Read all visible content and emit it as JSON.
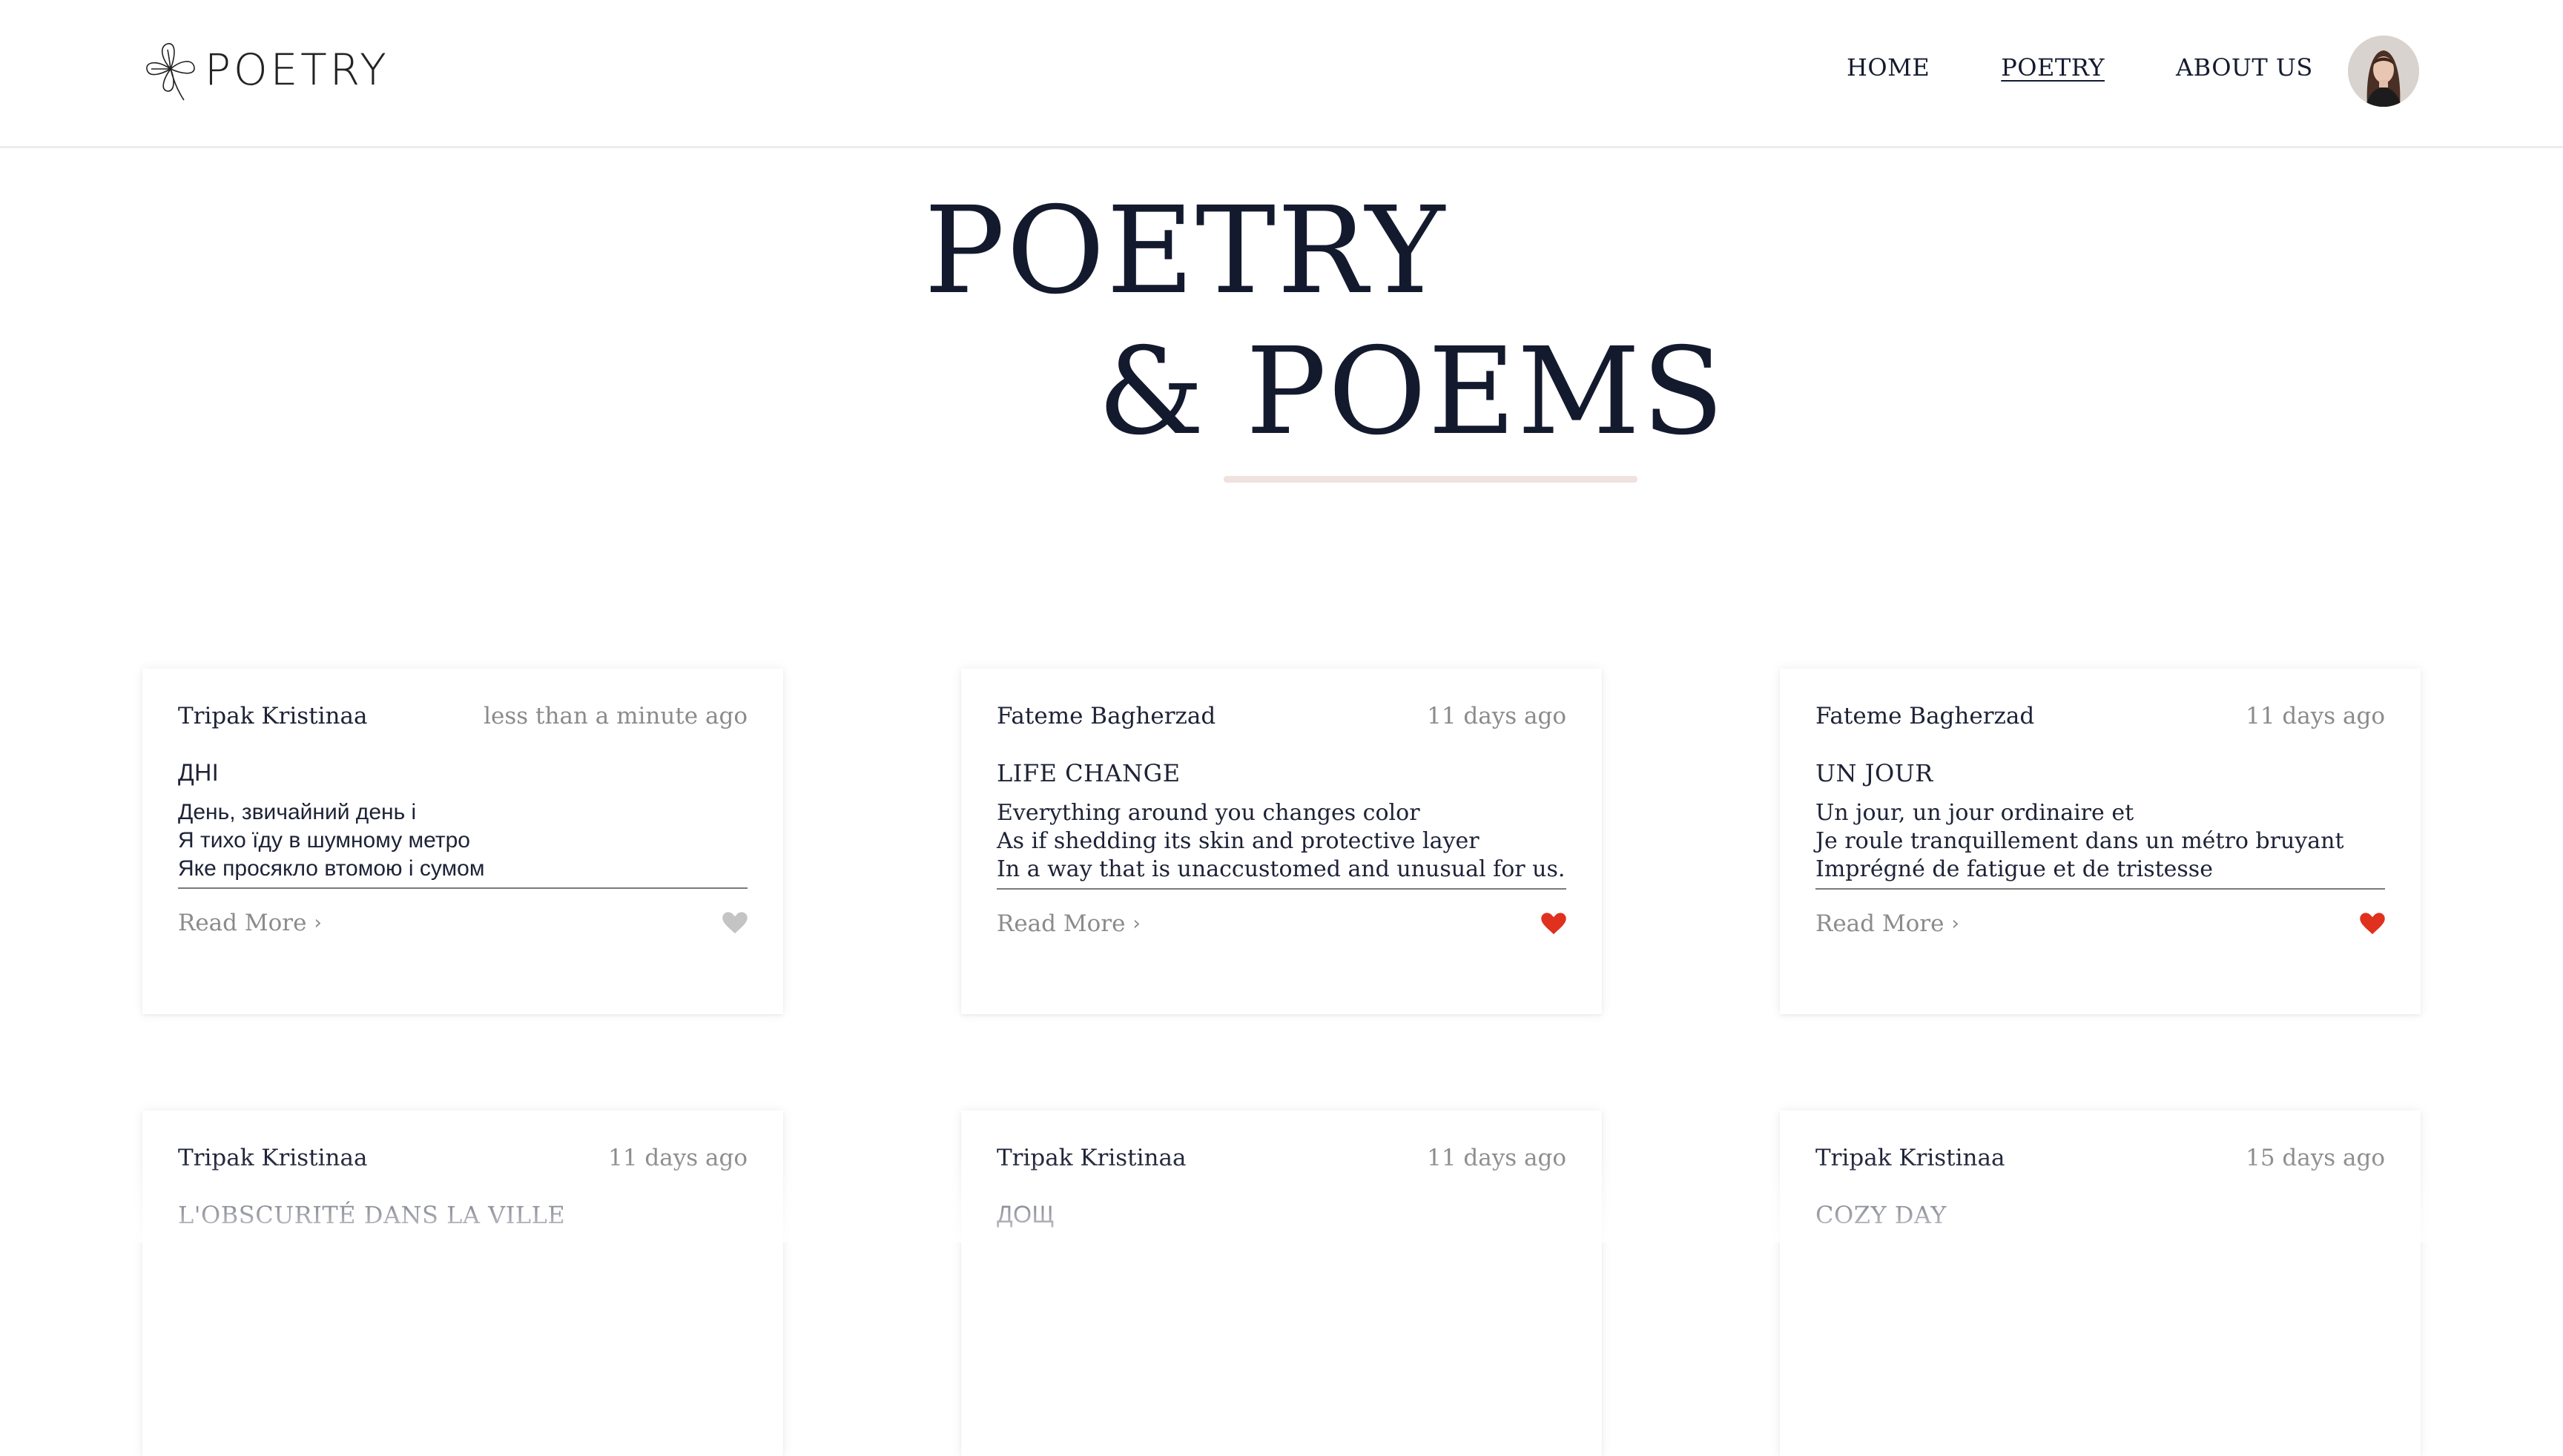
{
  "header": {
    "logo_text": "POETRY",
    "nav": [
      {
        "label": "HOME",
        "active": false
      },
      {
        "label": "POETRY",
        "active": true
      },
      {
        "label": "ABOUT US",
        "active": false
      }
    ]
  },
  "hero": {
    "line1": "POETRY",
    "line2": "& POEMS"
  },
  "cards": [
    {
      "author": "Tripak Kristinaa",
      "time": "less than a minute ago",
      "title": "ДНІ",
      "excerpt": [
        "День, звичайний день і",
        "Я тихо їду в шумному метро",
        "Яке просякло втомою і сумом"
      ],
      "read_more": "Read More",
      "liked": false
    },
    {
      "author": "Fateme Bagherzad",
      "time": "11 days ago",
      "title": "LIFE CHANGE",
      "excerpt": [
        "Everything around you changes color",
        "As if shedding its skin and protective layer",
        "In a way that is unaccustomed and unusual for us."
      ],
      "read_more": "Read More",
      "liked": true
    },
    {
      "author": "Fateme Bagherzad",
      "time": "11 days ago",
      "title": "UN JOUR",
      "excerpt": [
        "Un jour, un jour ordinaire et",
        "Je roule tranquillement dans un métro bruyant",
        "Imprégné de fatigue et de tristesse"
      ],
      "read_more": "Read More",
      "liked": true
    },
    {
      "author": "Tripak Kristinaa",
      "time": "11 days ago",
      "title": "L'OBSCURITÉ DANS LA VILLE"
    },
    {
      "author": "Tripak Kristinaa",
      "time": "11 days ago",
      "title": "ДОЩ"
    },
    {
      "author": "Tripak Kristinaa",
      "time": "15 days ago",
      "title": "COZY DAY"
    }
  ],
  "colors": {
    "text": "#141a2e",
    "muted": "#8b8b8b",
    "heart_liked": "#e0301e",
    "heart_unliked": "#c4c4c4",
    "hero_underline": "#efe2df"
  },
  "icons": {
    "logo": "clover-flower-icon",
    "read_more": "chevron-right-icon",
    "like": "heart-icon"
  }
}
